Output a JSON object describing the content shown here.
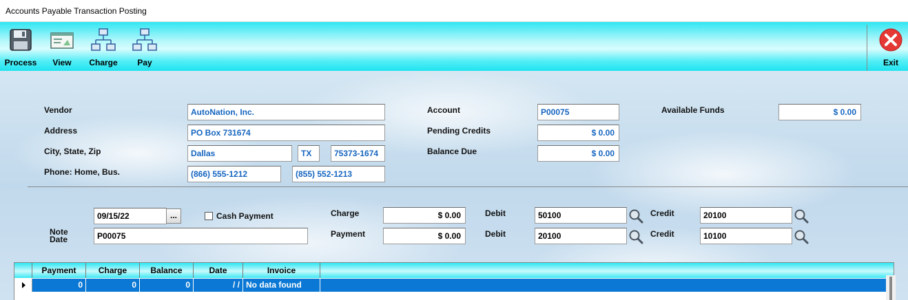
{
  "window": {
    "title": "Accounts Payable Transaction Posting"
  },
  "toolbar": {
    "process": "Process",
    "view": "View",
    "charge": "Charge",
    "pay": "Pay",
    "exit": "Exit"
  },
  "vendor": {
    "vendor_label": "Vendor",
    "vendor_value": "AutoNation, Inc.",
    "address_label": "Address",
    "address_value": "PO Box 731674",
    "csz_label": "City, State, Zip",
    "city": "Dallas",
    "state": "TX",
    "zip": "75373-1674",
    "phone_label": "Phone: Home, Bus.",
    "phone_home": "(866) 555-1212",
    "phone_bus": "(855) 552-1213"
  },
  "account": {
    "account_label": "Account",
    "account_value": "P00075",
    "pending_label": "Pending Credits",
    "pending_value": "$    0.00",
    "balance_label": "Balance Due",
    "balance_value": "$    0.00",
    "funds_label": "Available Funds",
    "funds_value": "$    0.00"
  },
  "entry": {
    "date_value": "09/15/22",
    "ellipsis": "...",
    "cash_label": "Cash Payment",
    "note_label_line1": "Note",
    "note_label_line2": "Date",
    "note_value": "P00075",
    "charge_label": "Charge",
    "charge_value": "$    0.00",
    "payment_label": "Payment",
    "payment_value": "$    0.00",
    "debit_label": "Debit",
    "debit1_value": "50100",
    "debit2_value": "20100",
    "credit_label": "Credit",
    "credit1_value": "20100",
    "credit2_value": "10100"
  },
  "grid": {
    "columns": [
      "Payment",
      "Charge",
      "Balance",
      "Date",
      "Invoice"
    ],
    "rows": [
      {
        "payment": "0",
        "charge": "0",
        "balance": "0",
        "date": "/ /",
        "invoice": "No data found"
      }
    ]
  },
  "colors": {
    "toolbar_cyan": "#2fe6f2",
    "field_text_blue": "#1565c0",
    "selected_row_blue": "#0a78d4",
    "exit_red": "#e53935"
  }
}
